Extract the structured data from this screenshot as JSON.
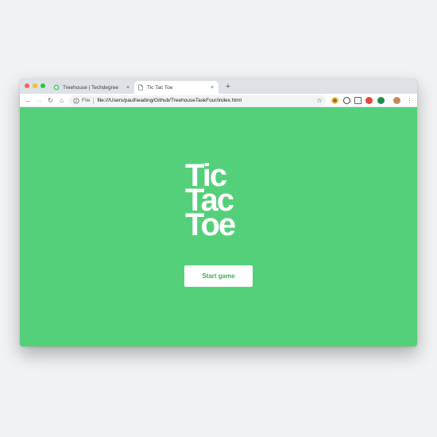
{
  "browser": {
    "tabs": [
      {
        "title": "Treehouse | Techdegree",
        "close": "×",
        "favicon": "treehouse-logo-icon"
      },
      {
        "title": "Tic Tac Toe",
        "close": "×",
        "favicon": "document-icon"
      }
    ],
    "new_tab": "+",
    "toolbar": {
      "back": "←",
      "forward": "→",
      "reload": "↻",
      "home": "⌂",
      "scheme": "File",
      "url": "file:///Users/paulheading/Github/TreehouseTaskFour/index.html",
      "bookmark": "☆",
      "menu": "⋮"
    },
    "colors": {
      "page_background": "#55d07a",
      "button_text": "#3fae5c"
    }
  },
  "game": {
    "logo_lines": [
      "Tic",
      "Tac",
      "Toe"
    ],
    "start_label": "Start game"
  }
}
